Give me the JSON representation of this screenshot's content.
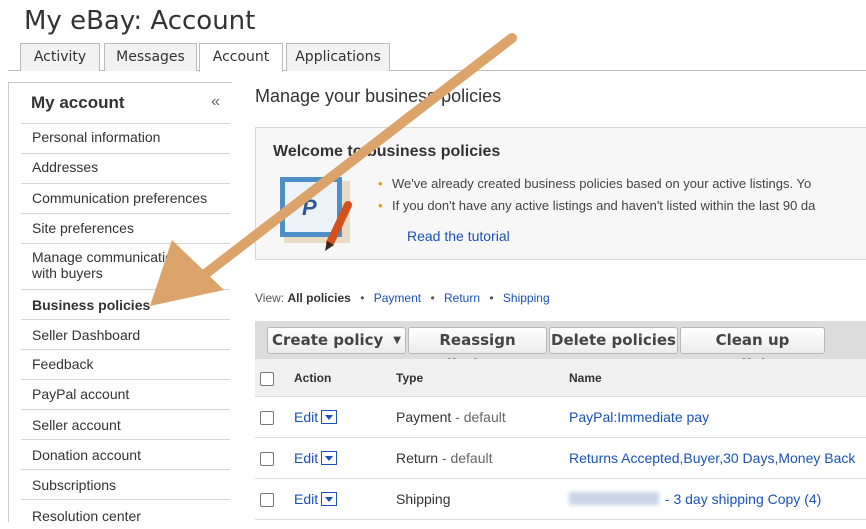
{
  "header": {
    "title": "My eBay: Account"
  },
  "tabs": [
    {
      "label": "Activity"
    },
    {
      "label": "Messages"
    },
    {
      "label": "Account"
    },
    {
      "label": "Applications"
    }
  ],
  "sidebar": {
    "title": "My account",
    "collapse_glyph": "«",
    "items": [
      {
        "label": "Personal information"
      },
      {
        "label": "Addresses"
      },
      {
        "label": "Communication preferences"
      },
      {
        "label": "Site preferences"
      },
      {
        "label": "Manage communications with buyers"
      },
      {
        "label": "Business policies"
      },
      {
        "label": "Seller Dashboard"
      },
      {
        "label": "Feedback"
      },
      {
        "label": "PayPal account"
      },
      {
        "label": "Seller account"
      },
      {
        "label": "Donation account"
      },
      {
        "label": "Subscriptions"
      },
      {
        "label": "Resolution center"
      }
    ]
  },
  "main": {
    "heading": "Manage your business policies",
    "welcome": {
      "title": "Welcome to business policies",
      "bullets": [
        "We've already created business policies based on your active listings. Yo",
        "If you don't have any active listings and haven't listed within the last 90 da"
      ],
      "tutorial_link": "Read the tutorial"
    },
    "view": {
      "prefix": "View:",
      "current": "All policies",
      "sep": "•",
      "links": [
        "Payment",
        "Return",
        "Shipping"
      ]
    },
    "toolbar": {
      "create": "Create policy",
      "reassign": "Reassign listings",
      "delete": "Delete policies",
      "cleanup": "Clean up policies"
    },
    "table": {
      "headers": {
        "action": "Action",
        "type": "Type",
        "name": "Name"
      },
      "rows": [
        {
          "edit": "Edit",
          "type": "Payment",
          "suffix": " - default",
          "name": "PayPal:Immediate pay"
        },
        {
          "edit": "Edit",
          "type": "Return",
          "suffix": " - default",
          "name": "Returns Accepted,Buyer,30 Days,Money Back"
        },
        {
          "edit": "Edit",
          "type": "Shipping",
          "suffix": "",
          "name": " - 3 day shipping Copy (4)"
        }
      ]
    }
  },
  "colors": {
    "accent_link": "#1a52b8",
    "arrow": "#dca46a",
    "bullet": "#e0a100"
  }
}
